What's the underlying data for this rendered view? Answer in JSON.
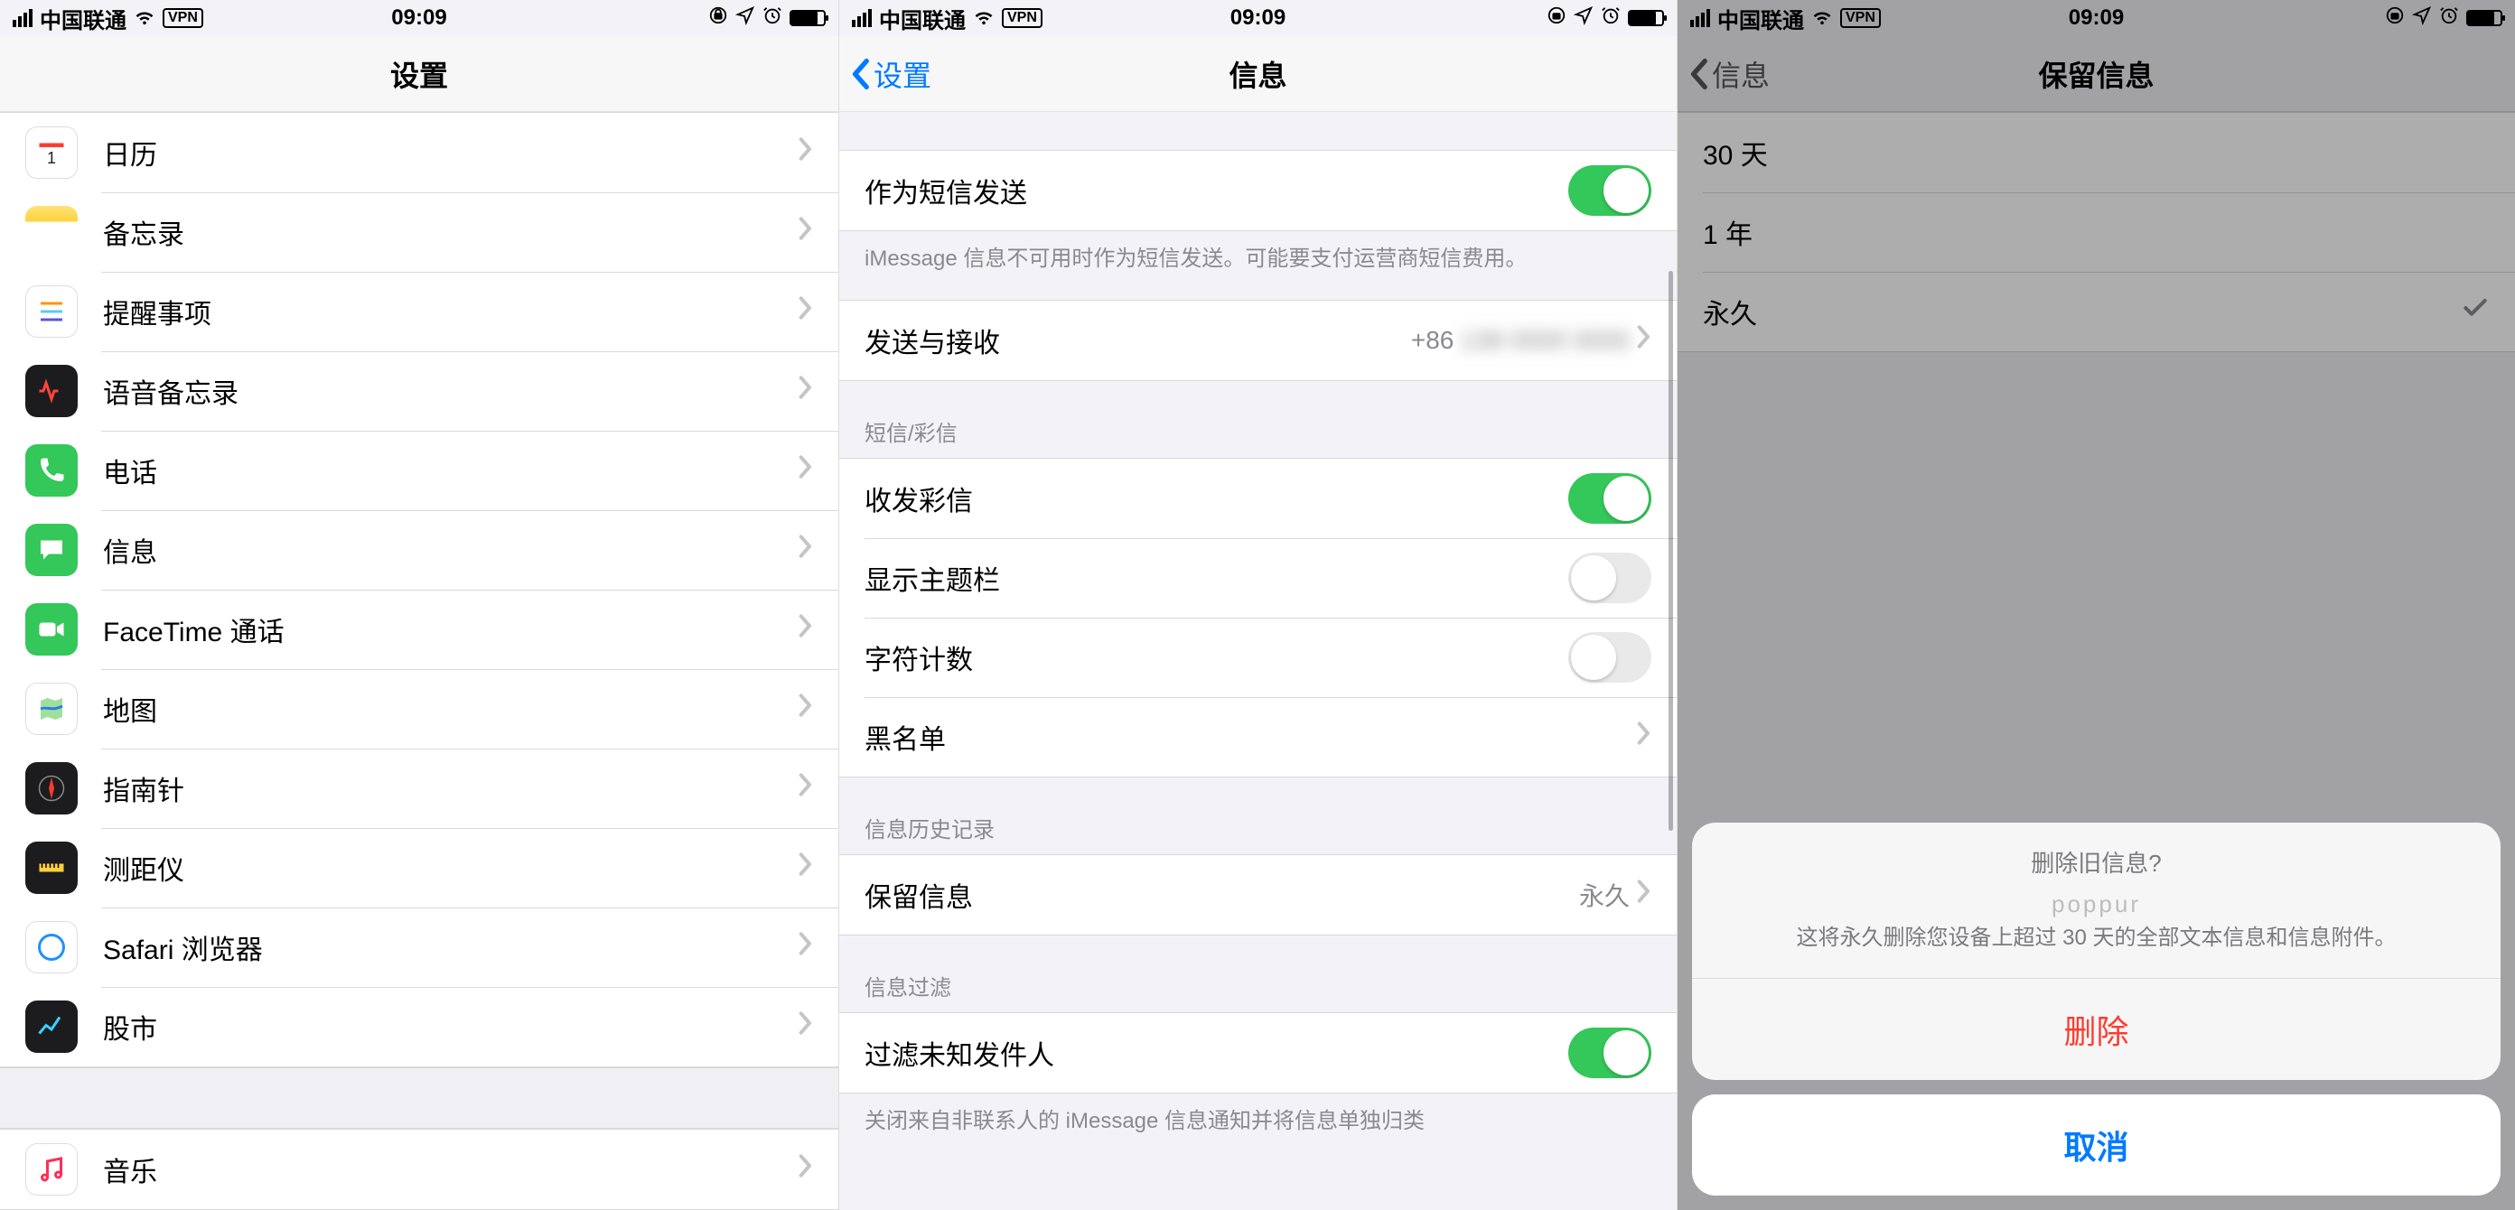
{
  "status": {
    "carrier": "中国联通",
    "vpn": "VPN",
    "time": "09:09"
  },
  "panel1": {
    "title": "设置",
    "items": [
      {
        "label": "日历",
        "icon_bg": "#ffffff",
        "icon_fg": "#ff3b30",
        "icon_border": true
      },
      {
        "label": "备忘录",
        "icon_bg": "linear-gradient(#ffe27a,#ffd23a 30%,#fff 30%)"
      },
      {
        "label": "提醒事项",
        "icon_bg": "#ffffff",
        "icon_border": true
      },
      {
        "label": "语音备忘录",
        "icon_bg": "#1c1c1e"
      },
      {
        "label": "电话",
        "icon_bg": "#34c759"
      },
      {
        "label": "信息",
        "icon_bg": "#34c759"
      },
      {
        "label": "FaceTime 通话",
        "icon_bg": "#34c759"
      },
      {
        "label": "地图",
        "icon_bg": "#ffffff",
        "icon_border": true
      },
      {
        "label": "指南针",
        "icon_bg": "#1c1c1e"
      },
      {
        "label": "测距仪",
        "icon_bg": "#1c1c1e"
      },
      {
        "label": "Safari 浏览器",
        "icon_bg": "#ffffff",
        "icon_border": true
      },
      {
        "label": "股市",
        "icon_bg": "#1c1c1e"
      }
    ],
    "items2": [
      {
        "label": "音乐",
        "icon_bg": "#ffffff",
        "icon_border": true
      }
    ]
  },
  "panel2": {
    "back": "设置",
    "title": "信息",
    "sendAsSms": {
      "label": "作为短信发送",
      "on": true
    },
    "sendAsSmsFooter": "iMessage 信息不可用时作为短信发送。可能要支付运营商短信费用。",
    "sendReceive": {
      "label": "发送与接收",
      "value": "+86"
    },
    "smsHeader": "短信/彩信",
    "mms": {
      "label": "收发彩信",
      "on": true
    },
    "subject": {
      "label": "显示主题栏",
      "on": false
    },
    "charCount": {
      "label": "字符计数",
      "on": false
    },
    "blacklist": {
      "label": "黑名单"
    },
    "historyHeader": "信息历史记录",
    "keep": {
      "label": "保留信息",
      "value": "永久"
    },
    "filterHeader": "信息过滤",
    "filterUnknown": {
      "label": "过滤未知发件人",
      "on": true
    },
    "filterFooter": "关闭来自非联系人的 iMessage 信息通知并将信息单独归类"
  },
  "panel3": {
    "back": "信息",
    "title": "保留信息",
    "options": [
      {
        "label": "30 天",
        "selected": false
      },
      {
        "label": "1 年",
        "selected": false
      },
      {
        "label": "永久",
        "selected": true
      }
    ],
    "sheet": {
      "title": "删除旧信息?",
      "watermark": "poppur",
      "message": "这将永久删除您设备上超过 30 天的全部文本信息和信息附件。",
      "delete": "删除",
      "cancel": "取消"
    }
  }
}
